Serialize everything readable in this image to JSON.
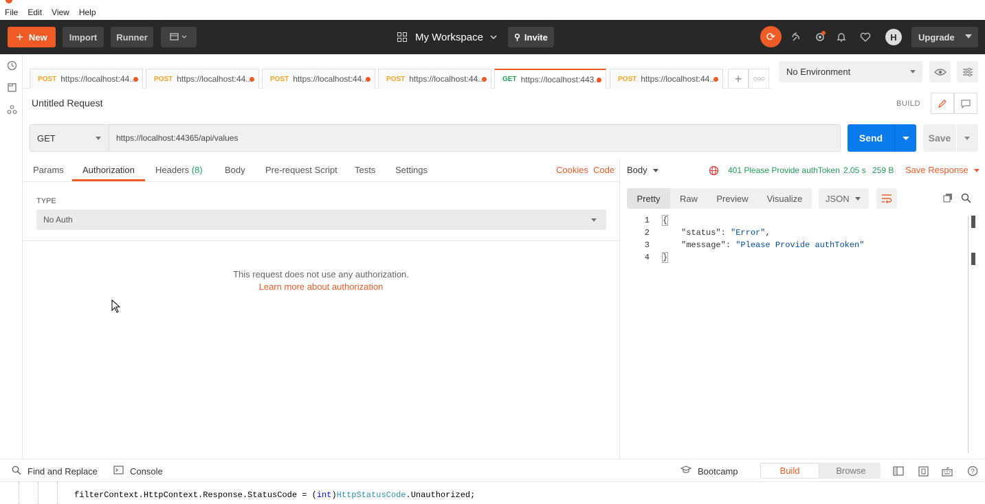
{
  "menubar": {
    "items": [
      "File",
      "Edit",
      "View",
      "Help"
    ]
  },
  "header": {
    "new_label": "New",
    "import_label": "Import",
    "runner_label": "Runner",
    "workspace_label": "My Workspace",
    "invite_label": "Invite",
    "avatar_initial": "H",
    "upgrade_label": "Upgrade",
    "accent_color": "#ef5b25"
  },
  "tabs": [
    {
      "method": "POST",
      "url": "https://localhost:44..."
    },
    {
      "method": "POST",
      "url": "https://localhost:44..."
    },
    {
      "method": "POST",
      "url": "https://localhost:44..."
    },
    {
      "method": "POST",
      "url": "https://localhost:44..."
    },
    {
      "method": "GET",
      "url": "https://localhost:443..."
    },
    {
      "method": "POST",
      "url": "https://localhost:44..."
    }
  ],
  "environment": {
    "selected": "No Environment"
  },
  "request": {
    "title": "Untitled Request",
    "build_label": "BUILD",
    "method": "GET",
    "url": "https://localhost:44365/api/values",
    "send_label": "Send",
    "save_label": "Save",
    "subtabs": {
      "params": "Params",
      "authorization": "Authorization",
      "headers": "Headers",
      "headers_count": "(8)",
      "body": "Body",
      "prerequest": "Pre-request Script",
      "tests": "Tests",
      "settings": "Settings"
    },
    "cookies_label": "Cookies",
    "code_label": "Code",
    "auth": {
      "type_label": "TYPE",
      "type_value": "No Auth",
      "message": "This request does not use any authorization.",
      "learn_more": "Learn more about authorization"
    }
  },
  "response": {
    "body_label": "Body",
    "status": "401 Please Provide authToken",
    "time": "2.05 s",
    "size": "259 B",
    "save_response_label": "Save Response",
    "views": [
      "Pretty",
      "Raw",
      "Preview",
      "Visualize"
    ],
    "active_view": "Pretty",
    "language": "JSON",
    "lines": [
      {
        "n": "1",
        "open": "{"
      },
      {
        "n": "2",
        "key": "\"status\"",
        "sep": ": ",
        "value": "\"Error\"",
        "tail": ","
      },
      {
        "n": "3",
        "key": "\"message\"",
        "sep": ": ",
        "value": "\"Please Provide authToken\"",
        "tail": ""
      },
      {
        "n": "4",
        "open": "}"
      }
    ]
  },
  "statusbar": {
    "find_replace": "Find and Replace",
    "console": "Console",
    "bootcamp": "Bootcamp",
    "build": "Build",
    "browse": "Browse"
  },
  "editor": {
    "line1_a": "filterContext.HttpContext.Response.StatusCode = (",
    "line1_kw": "int",
    "line1_b": ")",
    "line1_ty": "HttpStatusCode",
    "line1_c": ".Unauthorized;"
  }
}
